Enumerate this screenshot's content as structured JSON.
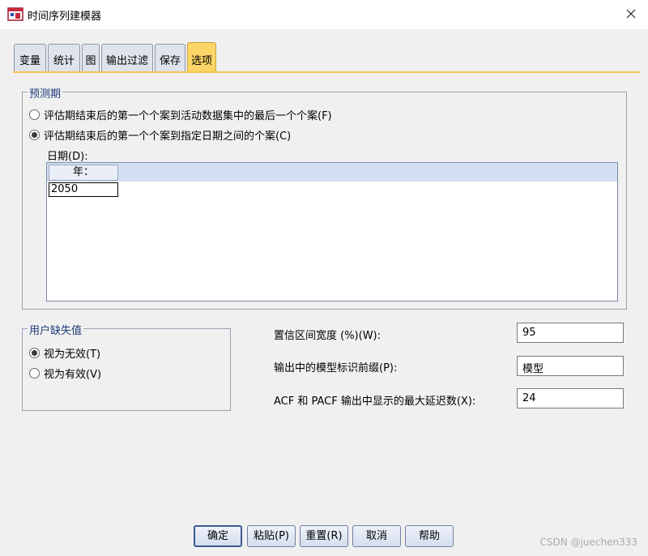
{
  "window": {
    "title": "时间序列建模器",
    "close_icon": "close-icon"
  },
  "tabs": [
    {
      "label": "变量",
      "active": false
    },
    {
      "label": "统计",
      "active": false
    },
    {
      "label": "图",
      "active": false
    },
    {
      "label": "输出过滤",
      "active": false
    },
    {
      "label": "保存",
      "active": false
    },
    {
      "label": "选项",
      "active": true
    }
  ],
  "forecast_period": {
    "legend": "预测期",
    "options": [
      {
        "label": "评估期结束后的第一个个案到活动数据集中的最后一个个案(F)",
        "selected": false
      },
      {
        "label": "评估期结束后的第一个个案到指定日期之间的个案(C)",
        "selected": true
      }
    ],
    "date_label": "日期(D):",
    "grid": {
      "columns": [
        "年："
      ],
      "values": [
        "2050"
      ]
    }
  },
  "missing_values": {
    "legend": "用户缺失值",
    "options": [
      {
        "label": "视为无效(T)",
        "selected": true
      },
      {
        "label": "视为有效(V)",
        "selected": false
      }
    ]
  },
  "settings": {
    "ci_width_label": "置信区间宽度 (%)(W):",
    "ci_width_value": "95",
    "prefix_label": "输出中的模型标识前缀(P):",
    "prefix_value": "模型",
    "max_lags_label": "ACF 和 PACF 输出中显示的最大延迟数(X):",
    "max_lags_value": "24"
  },
  "buttons": {
    "ok": "确定",
    "paste": "粘贴(P)",
    "reset": "重置(R)",
    "cancel": "取消",
    "help": "帮助"
  },
  "watermark": "CSDN @juechen333",
  "colors": {
    "active_tab": "#fbd566",
    "group_legend": "#1d3b78",
    "grid_header": "#d2dff2"
  }
}
